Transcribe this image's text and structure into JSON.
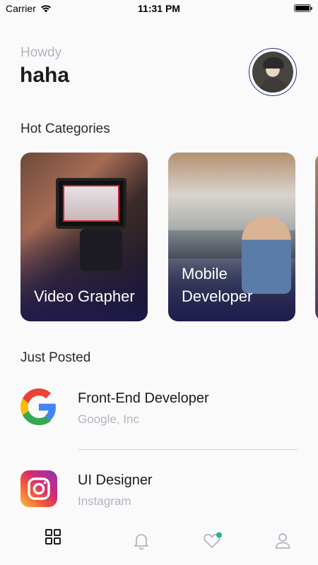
{
  "status_bar": {
    "carrier": "Carrier",
    "time": "11:31 PM",
    "icons": [
      "wifi-icon",
      "battery-icon"
    ]
  },
  "header": {
    "greeting": "Howdy",
    "username": "haha",
    "avatar_icon": "avatar-photo"
  },
  "sections": {
    "categories_title": "Hot Categories",
    "posted_title": "Just Posted"
  },
  "categories": [
    {
      "label": "Video Grapher"
    },
    {
      "label": "Mobile Developer"
    },
    {
      "label": ""
    }
  ],
  "jobs": [
    {
      "title": "Front-End Developer",
      "company": "Google, Inc",
      "logo": "google-logo"
    },
    {
      "title": "UI Designer",
      "company": "Instagram",
      "logo": "instagram-logo"
    }
  ],
  "bottom_nav": {
    "items": [
      {
        "icon": "grid-icon",
        "active": true
      },
      {
        "icon": "bell-icon",
        "active": false
      },
      {
        "icon": "heart-icon",
        "active": false,
        "badge_color": "#1fb88a"
      },
      {
        "icon": "user-icon",
        "active": false
      }
    ]
  },
  "colors": {
    "accent": "#2b2e84",
    "muted_text": "#b3b3c3",
    "badge": "#1fb88a"
  }
}
